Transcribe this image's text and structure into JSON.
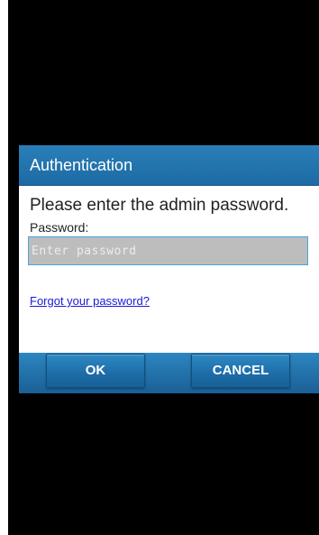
{
  "dialog": {
    "title": "Authentication",
    "prompt": "Please enter the admin password.",
    "password_label": "Password:",
    "password_placeholder": "Enter password",
    "password_value": "",
    "forgot_link": "Forgot your password?",
    "ok_label": "OK",
    "cancel_label": "CANCEL"
  },
  "colors": {
    "header": "#1d6aa4",
    "input_border": "#4aa3d8",
    "link": "#1a1ad6",
    "backdrop": "#000000"
  }
}
